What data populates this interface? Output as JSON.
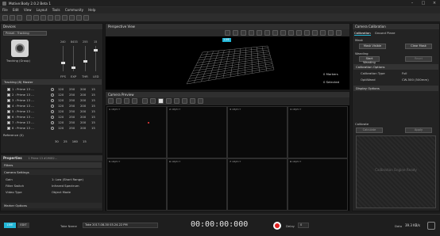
{
  "window": {
    "title": "Motive:Body 2.0.2 Beta 1"
  },
  "menu": [
    "File",
    "Edit",
    "View",
    "Layout",
    "Tools",
    "Community",
    "Help"
  ],
  "devices": {
    "title": "Devices",
    "preset": "Preset : Tracking",
    "camera_name": "Tracking (Group)",
    "col_labels": [
      "FPS",
      "EXP",
      "THR",
      "LED"
    ],
    "col_vals": [
      "240",
      "8433",
      "255",
      "15"
    ],
    "group": "Tracking (8) Master",
    "rows": [
      {
        "name": "1 : Prime 13 ...",
        "vals": [
          "120",
          "250",
          "200",
          "15"
        ]
      },
      {
        "name": "2 : Prime 13 ...",
        "vals": [
          "120",
          "250",
          "200",
          "15"
        ]
      },
      {
        "name": "3 : Prime 13 ...",
        "vals": [
          "120",
          "250",
          "200",
          "15"
        ]
      },
      {
        "name": "4 : Prime 13 ...",
        "vals": [
          "120",
          "250",
          "200",
          "15"
        ]
      },
      {
        "name": "5 : Prime 13 ...",
        "vals": [
          "120",
          "250",
          "200",
          "15"
        ]
      },
      {
        "name": "6 : Prime 13 ...",
        "vals": [
          "120",
          "250",
          "200",
          "15"
        ]
      },
      {
        "name": "7 : Prime 13 ...",
        "vals": [
          "120",
          "250",
          "200",
          "15"
        ]
      },
      {
        "name": "8 : Prime 13 ...",
        "vals": [
          "120",
          "250",
          "200",
          "15"
        ]
      }
    ],
    "reference": "Reference (0)",
    "ref_vals": [
      "30",
      "25",
      "160",
      "15"
    ]
  },
  "properties": {
    "title": "Properties",
    "selection": "1 Prime 13 #19082...",
    "filter": "Filters",
    "section": "Camera Settings",
    "fields": [
      {
        "k": "Gain",
        "v": "1: Low (Short Range)"
      },
      {
        "k": "Filter Switch",
        "v": "Infrared Spectrum"
      },
      {
        "k": "Video Type",
        "v": "Object Mode"
      }
    ],
    "footer": "Marker Options"
  },
  "perspective": {
    "title": "Perspective View",
    "live": "LIVE",
    "markers": "0 Markers",
    "selected": "0 Selected"
  },
  "camera_preview": {
    "title": "Camera Preview",
    "cells": [
      {
        "n": "1",
        "t": "OBJECT"
      },
      {
        "n": "2",
        "t": "OBJECT"
      },
      {
        "n": "3",
        "t": "OBJECT"
      },
      {
        "n": "4",
        "t": "OBJECT"
      },
      {
        "n": "5",
        "t": "OBJECT"
      },
      {
        "n": "6",
        "t": "OBJECT"
      },
      {
        "n": "7",
        "t": "OBJECT"
      },
      {
        "n": "8",
        "t": "OBJECT"
      }
    ]
  },
  "calibration": {
    "title": "Camera Calibration",
    "tabs": [
      "Calibration",
      "Ground Plane"
    ],
    "mask_label": "Mask",
    "mask_visible": "Mask Visible",
    "clear_mask": "Clear Mask",
    "wanding_label": "Wanding",
    "start_wanding": "Start Wanding",
    "reset": "Reset",
    "cal_options": "Calibration Options",
    "cal_type_k": "Calibration Type",
    "cal_type_v": "Full",
    "optiwand_k": "OptiWand",
    "optiwand_v": "CW-500 (500mm)",
    "display_options": "Display Options",
    "calibrate_label": "Calibrate",
    "calculate": "Calculate",
    "apply": "Apply",
    "ready": "Calibration Engine Ready"
  },
  "timeline": {
    "live": "LIVE",
    "edit": "EDIT",
    "take_label": "Take Name",
    "take_name": "Take 2017-08-30 03.24.22 PM",
    "timecode": "00:00:00:000",
    "delay_label": "Delay",
    "delay": "0",
    "rate_label": "Data",
    "rate": "39.3 KB/s"
  },
  "colors": {
    "accent": "#22b6d6",
    "record": "#e02020"
  }
}
